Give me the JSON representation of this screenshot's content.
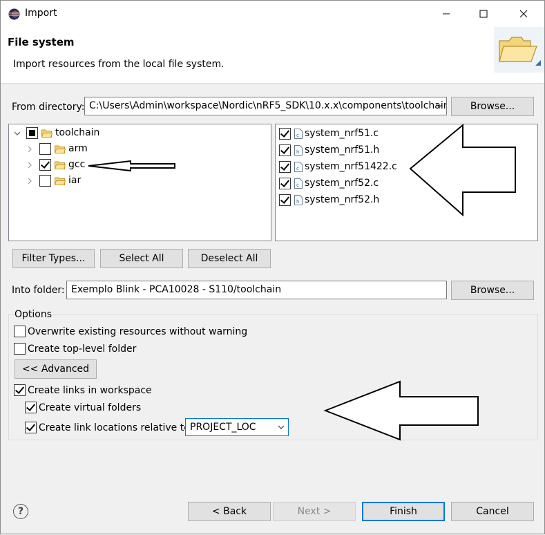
{
  "window": {
    "title": "Import"
  },
  "header": {
    "title": "File system",
    "description": "Import resources from the local file system."
  },
  "source": {
    "from_directory_label": "From directory:",
    "from_directory_value": "C:\\Users\\Admin\\workspace\\Nordic\\nRF5_SDK\\10.x.x\\components\\toolchain",
    "browse_label": "Browse..."
  },
  "tree": {
    "root": {
      "label": "toolchain",
      "state": "partial"
    },
    "children": [
      {
        "label": "arm",
        "checked": false
      },
      {
        "label": "gcc",
        "checked": true
      },
      {
        "label": "iar",
        "checked": false
      }
    ]
  },
  "files": [
    {
      "label": "system_nrf51.c",
      "checked": true
    },
    {
      "label": "system_nrf51.h",
      "checked": true
    },
    {
      "label": "system_nrf51422.c",
      "checked": true
    },
    {
      "label": "system_nrf52.c",
      "checked": true
    },
    {
      "label": "system_nrf52.h",
      "checked": true
    }
  ],
  "selection_buttons": {
    "filter_types": "Filter Types...",
    "select_all": "Select All",
    "deselect_all": "Deselect All"
  },
  "destination": {
    "into_folder_label": "Into folder:",
    "into_folder_value": "Exemplo Blink - PCA10028 - S110/toolchain",
    "browse_label": "Browse..."
  },
  "options": {
    "group_label": "Options",
    "overwrite_label": "Overwrite existing resources without warning",
    "overwrite_checked": false,
    "top_level_label": "Create top-level folder",
    "top_level_checked": false,
    "advanced_label": "<< Advanced",
    "create_links_label": "Create links in workspace",
    "create_links_checked": true,
    "virtual_folders_label": "Create virtual folders",
    "virtual_folders_checked": true,
    "relative_label": "Create link locations relative to:",
    "relative_checked": true,
    "relative_value": "PROJECT_LOC"
  },
  "footer": {
    "back_label": "< Back",
    "next_label": "Next >",
    "finish_label": "Finish",
    "cancel_label": "Cancel"
  },
  "icons": [
    "eclipse-app-icon",
    "minimize-icon",
    "maximize-icon",
    "close-icon",
    "folder-banner-icon",
    "folder-icon",
    "file-c-icon",
    "file-h-icon",
    "chevron-down-icon",
    "chevron-right-icon",
    "help-icon",
    "annotation-arrow"
  ]
}
